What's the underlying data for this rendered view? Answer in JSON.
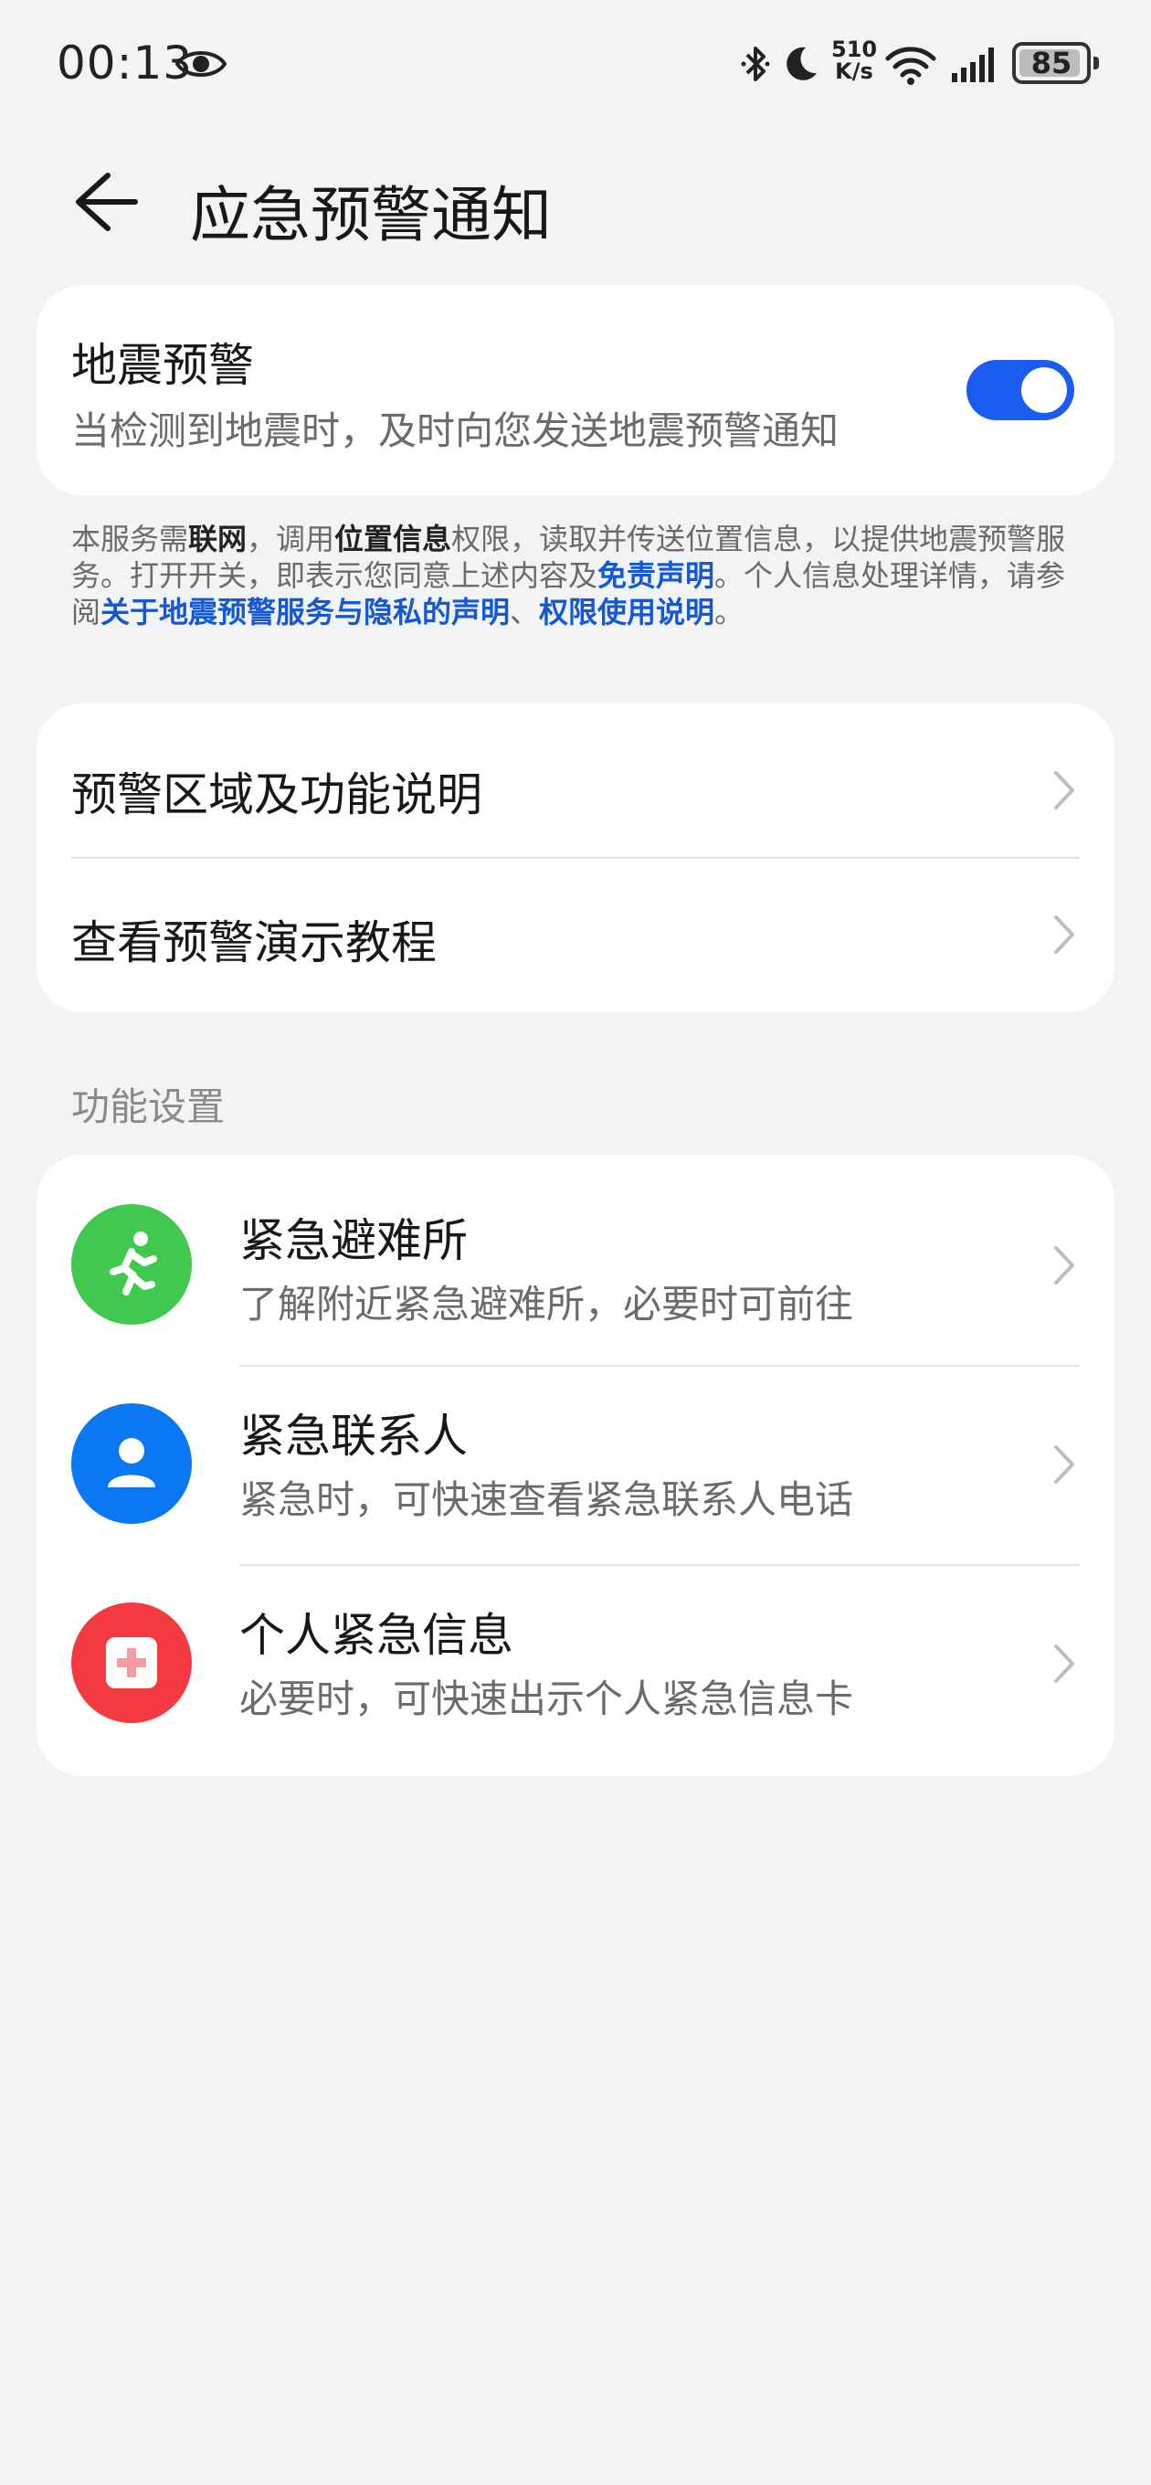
{
  "status_bar": {
    "time": "00:13",
    "net_speed_value": "510",
    "net_speed_unit": "K/s",
    "battery_level": "85"
  },
  "header": {
    "title": "应急预警通知"
  },
  "earthquake_card": {
    "title": "地震预警",
    "subtitle": "当检测到地震时，及时向您发送地震预警通知",
    "toggle_on": true,
    "toggle_color": "#1a5bf0"
  },
  "notice": {
    "part1": "本服务需",
    "bold1": "联网",
    "part2": "，调用",
    "bold2": "位置信息",
    "part3": "权限，读取并传送位置信息，以提供地震预警服务。打开开关，即表示您同意上述内容及",
    "link1": "免责声明",
    "part4": "。个人信息处理详情，请参阅",
    "link2": "关于地震预警服务与隐私的声明",
    "part5": "、",
    "link3": "权限使用说明",
    "part6": "。"
  },
  "links": [
    {
      "label": "预警区域及功能说明"
    },
    {
      "label": "查看预警演示教程"
    }
  ],
  "section": {
    "title": "功能设置"
  },
  "features": [
    {
      "title": "紧急避难所",
      "subtitle": "了解附近紧急避难所，必要时可前往",
      "icon": "running-person-icon",
      "color": "#41c94f"
    },
    {
      "title": "紧急联系人",
      "subtitle": "紧急时，可快速查看紧急联系人电话",
      "icon": "person-icon",
      "color": "#0a77f5"
    },
    {
      "title": "个人紧急信息",
      "subtitle": "必要时，可快速出示个人紧急信息卡",
      "icon": "medical-cross-icon",
      "color": "#f33a41"
    }
  ]
}
